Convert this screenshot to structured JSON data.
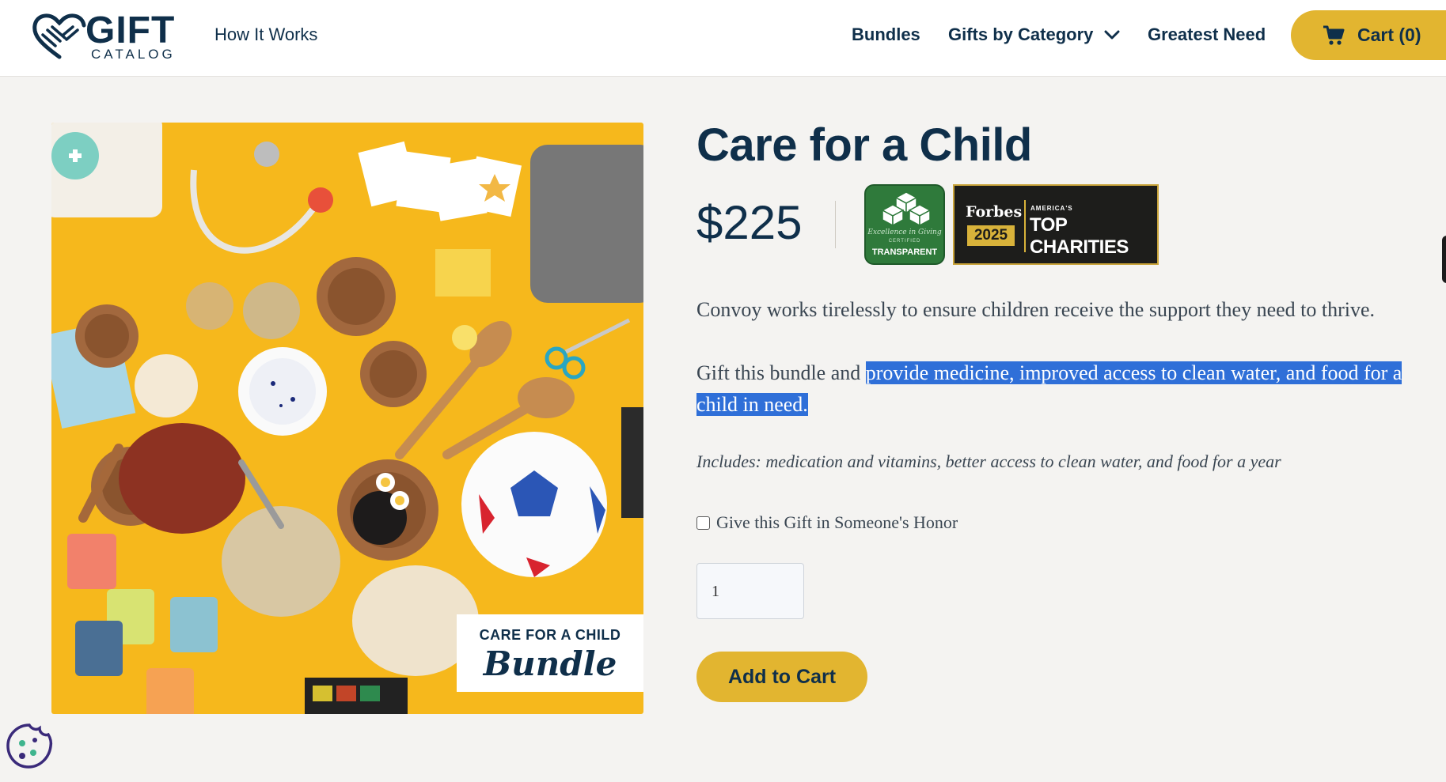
{
  "header": {
    "logo_word": "GIFT",
    "logo_sub": "CATALOG",
    "how_it_works": "How It Works",
    "nav": {
      "bundles": "Bundles",
      "gifts_by_category": "Gifts by Category",
      "greatest_need": "Greatest Need"
    },
    "cart_label": "Cart (0)"
  },
  "product": {
    "title": "Care for a Child",
    "price": "$225",
    "image_card": {
      "line1": "CARE FOR A CHILD",
      "line2": "Bundle"
    },
    "badges": {
      "transparent": {
        "line1": "Excellence in Giving",
        "line2": "CERTIFIED",
        "line3": "TRANSPARENT"
      },
      "forbes": {
        "brand": "Forbes",
        "year": "2025",
        "line1": "AMERICA'S",
        "line2": "TOP CHARITIES"
      }
    },
    "description": "Convoy works tirelessly to ensure children receive the support they need to thrive.",
    "gift_intro": "Gift this bundle and ",
    "gift_highlight": "provide medicine, improved access to clean water, and food for a child in need.",
    "includes": "Includes: medication and vitamins, better access to clean water, and food for a year",
    "honor_label": "Give this Gift in Someone's Honor",
    "quantity": "1",
    "add_to_cart": "Add to Cart"
  },
  "colors": {
    "navy": "#0f2f4a",
    "gold": "#e2b530",
    "background": "#f4f3f1",
    "highlight": "#2f6fd8"
  }
}
